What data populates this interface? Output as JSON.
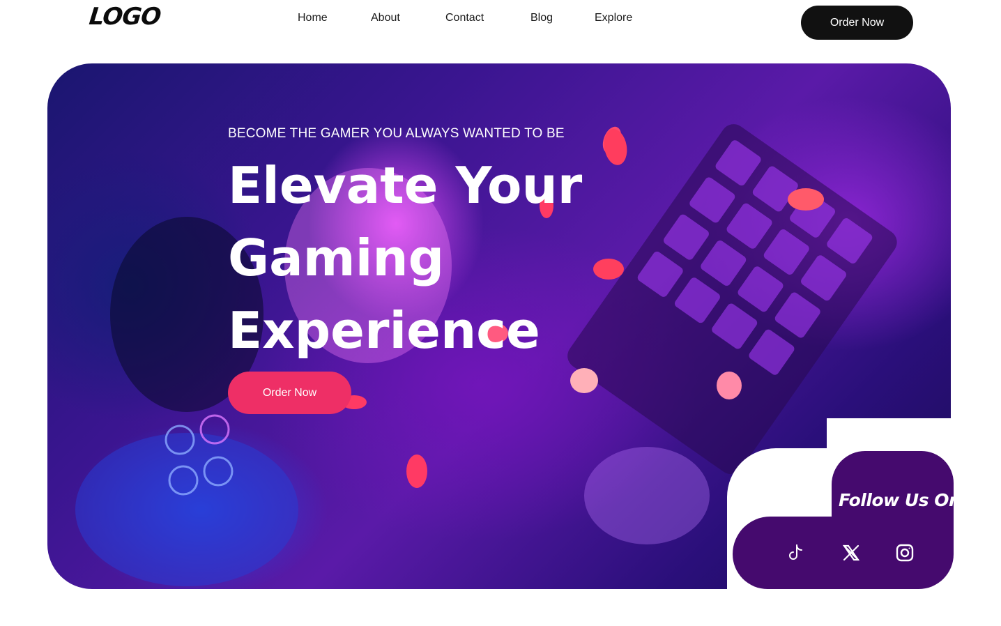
{
  "header": {
    "logo": "LOGO",
    "nav": [
      {
        "label": "Home"
      },
      {
        "label": "About"
      },
      {
        "label": "Contact"
      },
      {
        "label": "Blog"
      },
      {
        "label": "Explore"
      }
    ],
    "cta": "Order Now"
  },
  "hero": {
    "tagline": "BECOME THE GAMER YOU ALWAYS WANTED TO BE",
    "headline_lines": [
      "Elevate Your",
      "Gaming",
      "Experience"
    ],
    "cta": "Order Now"
  },
  "follow": {
    "title": "Follow Us On",
    "socials": [
      {
        "icon": "tiktok-icon"
      },
      {
        "icon": "x-icon"
      },
      {
        "icon": "instagram-icon"
      }
    ]
  },
  "colors": {
    "accent": "#ee2f66",
    "panel": "#450a6e",
    "dark_button": "#111111"
  }
}
